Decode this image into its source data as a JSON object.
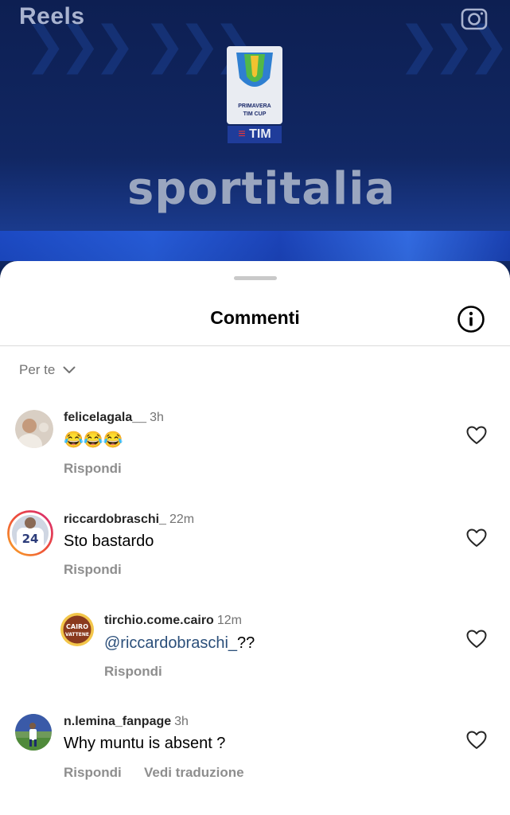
{
  "header": {
    "title": "Reels",
    "camera_icon": "camera-icon"
  },
  "reel": {
    "cup_label_1": "PRIMAVERA",
    "cup_label_2": "TIM CUP",
    "tim_mark": "TIM",
    "brand": "sportitalia"
  },
  "sheet": {
    "title": "Commenti",
    "info_icon": "info-icon",
    "sort_label": "Per te"
  },
  "comments": [
    {
      "username": "felicelagala__",
      "time": "3h",
      "text": "😂😂😂",
      "reply_label": "Rispondi"
    },
    {
      "username": "riccardobraschi_",
      "time": "22m",
      "text": "Sto bastardo",
      "reply_label": "Rispondi",
      "avatar_number": "24"
    },
    {
      "username": "tirchio.come.cairo",
      "time": "12m",
      "mention": "@riccardobraschi_",
      "text_after_mention": "??",
      "reply_label": "Rispondi",
      "avatar_text_1": "CAIRO",
      "avatar_text_2": "VATTENE"
    },
    {
      "username": "n.lemina_fanpage",
      "time": "3h",
      "text": "Why muntu is absent ?",
      "reply_label": "Rispondi",
      "translate_label": "Vedi traduzione"
    }
  ],
  "colors": {
    "reel_bg": "#0d1f52",
    "sheet_bg": "#ffffff",
    "secondary_text": "#8e8e8e",
    "mention": "#2b4f7a",
    "story_ring_start": "#f9a826",
    "story_ring_end": "#d62976"
  }
}
